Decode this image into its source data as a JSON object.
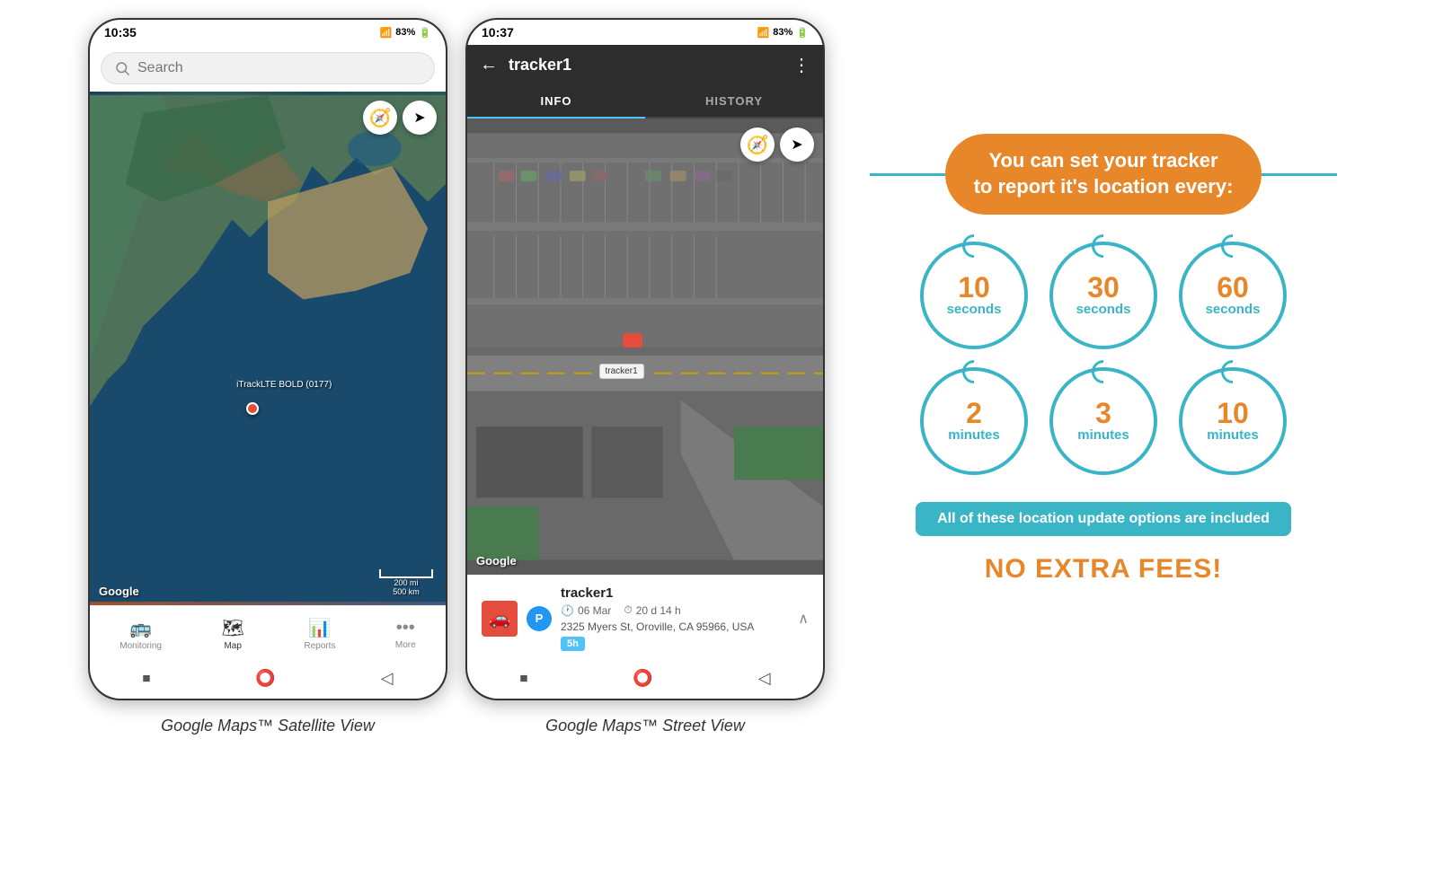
{
  "phone1": {
    "status": {
      "time": "10:35",
      "signal": "📶",
      "battery": "83%"
    },
    "search": {
      "placeholder": "Search"
    },
    "map": {
      "google_label": "Google",
      "scale_text_top": "200 mi",
      "scale_text_bottom": "500 km",
      "tracker_label": "iTrackLTE BOLD (0177)"
    },
    "nav": {
      "items": [
        {
          "icon": "🚌",
          "label": "Monitoring",
          "active": false
        },
        {
          "icon": "🗺",
          "label": "Map",
          "active": true
        },
        {
          "icon": "📊",
          "label": "Reports",
          "active": false
        },
        {
          "icon": "•••",
          "label": "More",
          "active": false
        }
      ]
    },
    "caption": "Google Maps™ Satellite View"
  },
  "phone2": {
    "status": {
      "time": "10:37",
      "signal": "📶",
      "battery": "83%"
    },
    "header": {
      "title": "tracker1",
      "back_label": "←",
      "more_label": "⋮"
    },
    "tabs": [
      {
        "label": "INFO",
        "active": true
      },
      {
        "label": "HISTORY",
        "active": false
      }
    ],
    "map": {
      "google_label": "Google",
      "tracker_map_label": "tracker1"
    },
    "tracker_info": {
      "name": "tracker1",
      "date": "06 Mar",
      "duration": "20 d 14 h",
      "address": "2325 Myers St, Oroville, CA 95966, USA",
      "badge": "5h"
    },
    "caption": "Google Maps™ Street View"
  },
  "infographic": {
    "headline": "You can set your tracker\nto report it's location every:",
    "circles": [
      {
        "number": "10",
        "unit": "seconds"
      },
      {
        "number": "30",
        "unit": "seconds"
      },
      {
        "number": "60",
        "unit": "seconds"
      },
      {
        "number": "2",
        "unit": "minutes"
      },
      {
        "number": "3",
        "unit": "minutes"
      },
      {
        "number": "10",
        "unit": "minutes"
      }
    ],
    "banner": "All of these location update options are included",
    "no_fees": "NO EXTRA FEES!",
    "colors": {
      "orange": "#e8872a",
      "teal": "#3ab5c6",
      "white": "#ffffff"
    }
  }
}
